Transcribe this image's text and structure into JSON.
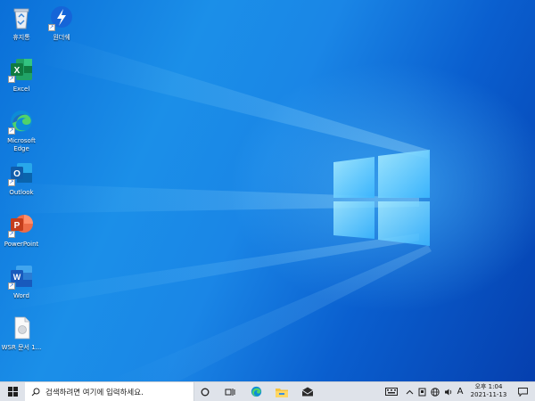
{
  "desktop": {
    "icons": [
      {
        "label": "휴지통",
        "icon": "recycle-bin-icon"
      },
      {
        "label": "원더쉐",
        "icon": "app-bolt-icon"
      },
      {
        "label": "Excel",
        "icon": "excel-icon"
      },
      {
        "label": "Microsoft Edge",
        "icon": "edge-icon"
      },
      {
        "label": "Outlook",
        "icon": "outlook-icon"
      },
      {
        "label": "PowerPoint",
        "icon": "powerpoint-icon"
      },
      {
        "label": "Word",
        "icon": "word-icon"
      },
      {
        "label": "WSR 문서 1...",
        "icon": "file-icon"
      }
    ]
  },
  "taskbar": {
    "search_placeholder": "검색하려면 여기에 입력하세요.",
    "tray": {
      "ime": "A",
      "time": "오후 1:04",
      "date": "2021-11-13"
    }
  },
  "colors": {
    "accent_blue": "#0a6fd8",
    "taskbar_bg": "#dfe3ea"
  }
}
